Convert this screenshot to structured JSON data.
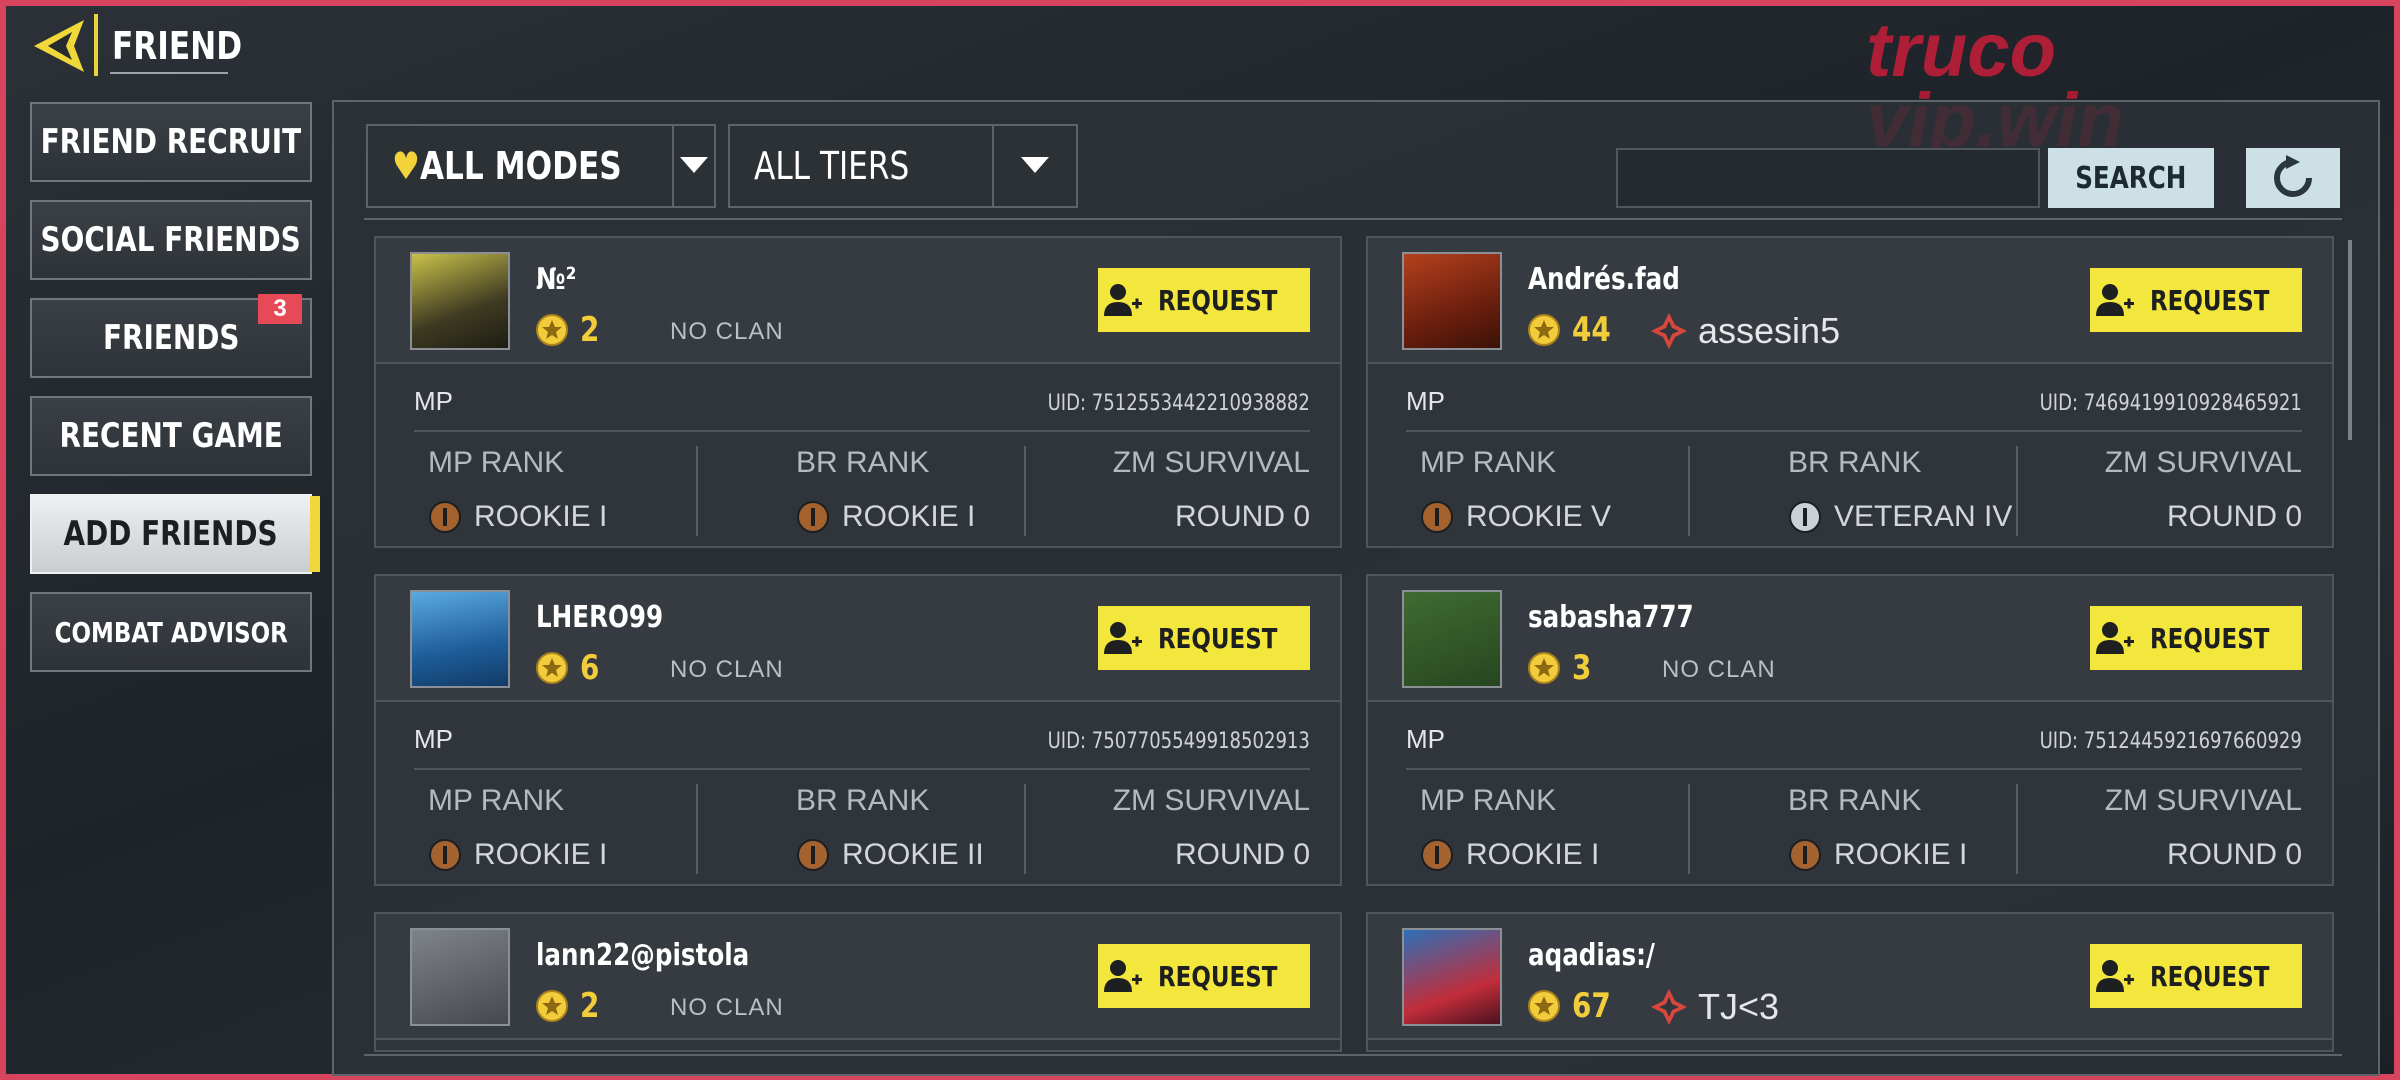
{
  "header": {
    "title": "FRIEND"
  },
  "sidebar": {
    "items": [
      {
        "label": "FRIEND RECRUIT"
      },
      {
        "label": "SOCIAL FRIENDS"
      },
      {
        "label": "FRIENDS",
        "badge": "3"
      },
      {
        "label": "RECENT GAME"
      },
      {
        "label": "ADD FRIENDS",
        "active": true
      },
      {
        "label": "COMBAT ADVISOR"
      }
    ]
  },
  "filters": {
    "modes": {
      "value": "ALL MODES",
      "icon": "heart-icon"
    },
    "tiers": {
      "value": "ALL TIERS"
    }
  },
  "search": {
    "placeholder": "",
    "button_label": "SEARCH"
  },
  "watermark": {
    "line1": "truco",
    "line2": "vip.win"
  },
  "colors": {
    "accent": "#f3e63c",
    "star": "#f2cc3a",
    "frame": "#d8435d",
    "badge": "#e74a57"
  },
  "players": [
    {
      "name": "№²",
      "level": "2",
      "clan": "NO CLAN",
      "has_clan": false,
      "request_label": "REQUEST",
      "mode": "MP",
      "uid": "UID: 7512553442210938882",
      "mp_rank_label": "MP RANK",
      "mp_rank": "ROOKIE I",
      "br_rank_label": "BR RANK",
      "br_rank": "ROOKIE I",
      "zm_label": "ZM SURVIVAL",
      "zm_value": "ROUND 0"
    },
    {
      "name": "Andrés.fad",
      "level": "44",
      "clan": "assesin5",
      "has_clan": true,
      "request_label": "REQUEST",
      "mode": "MP",
      "uid": "UID: 7469419910928465921",
      "mp_rank_label": "MP RANK",
      "mp_rank": "ROOKIE V",
      "br_rank_label": "BR RANK",
      "br_rank": "VETERAN IV",
      "zm_label": "ZM SURVIVAL",
      "zm_value": "ROUND 0"
    },
    {
      "name": "LHERO99",
      "level": "6",
      "clan": "NO CLAN",
      "has_clan": false,
      "request_label": "REQUEST",
      "mode": "MP",
      "uid": "UID: 7507705549918502913",
      "mp_rank_label": "MP RANK",
      "mp_rank": "ROOKIE I",
      "br_rank_label": "BR RANK",
      "br_rank": "ROOKIE II",
      "zm_label": "ZM SURVIVAL",
      "zm_value": "ROUND 0"
    },
    {
      "name": "sabasha777",
      "level": "3",
      "clan": "NO CLAN",
      "has_clan": false,
      "request_label": "REQUEST",
      "mode": "MP",
      "uid": "UID: 7512445921697660929",
      "mp_rank_label": "MP RANK",
      "mp_rank": "ROOKIE I",
      "br_rank_label": "BR RANK",
      "br_rank": "ROOKIE I",
      "zm_label": "ZM SURVIVAL",
      "zm_value": "ROUND 0"
    },
    {
      "name": "lann22@pistola",
      "level": "2",
      "clan": "NO CLAN",
      "has_clan": false,
      "request_label": "REQUEST"
    },
    {
      "name": "aqadias:/",
      "level": "67",
      "clan": "TJ<3",
      "has_clan": true,
      "request_label": "REQUEST"
    }
  ]
}
